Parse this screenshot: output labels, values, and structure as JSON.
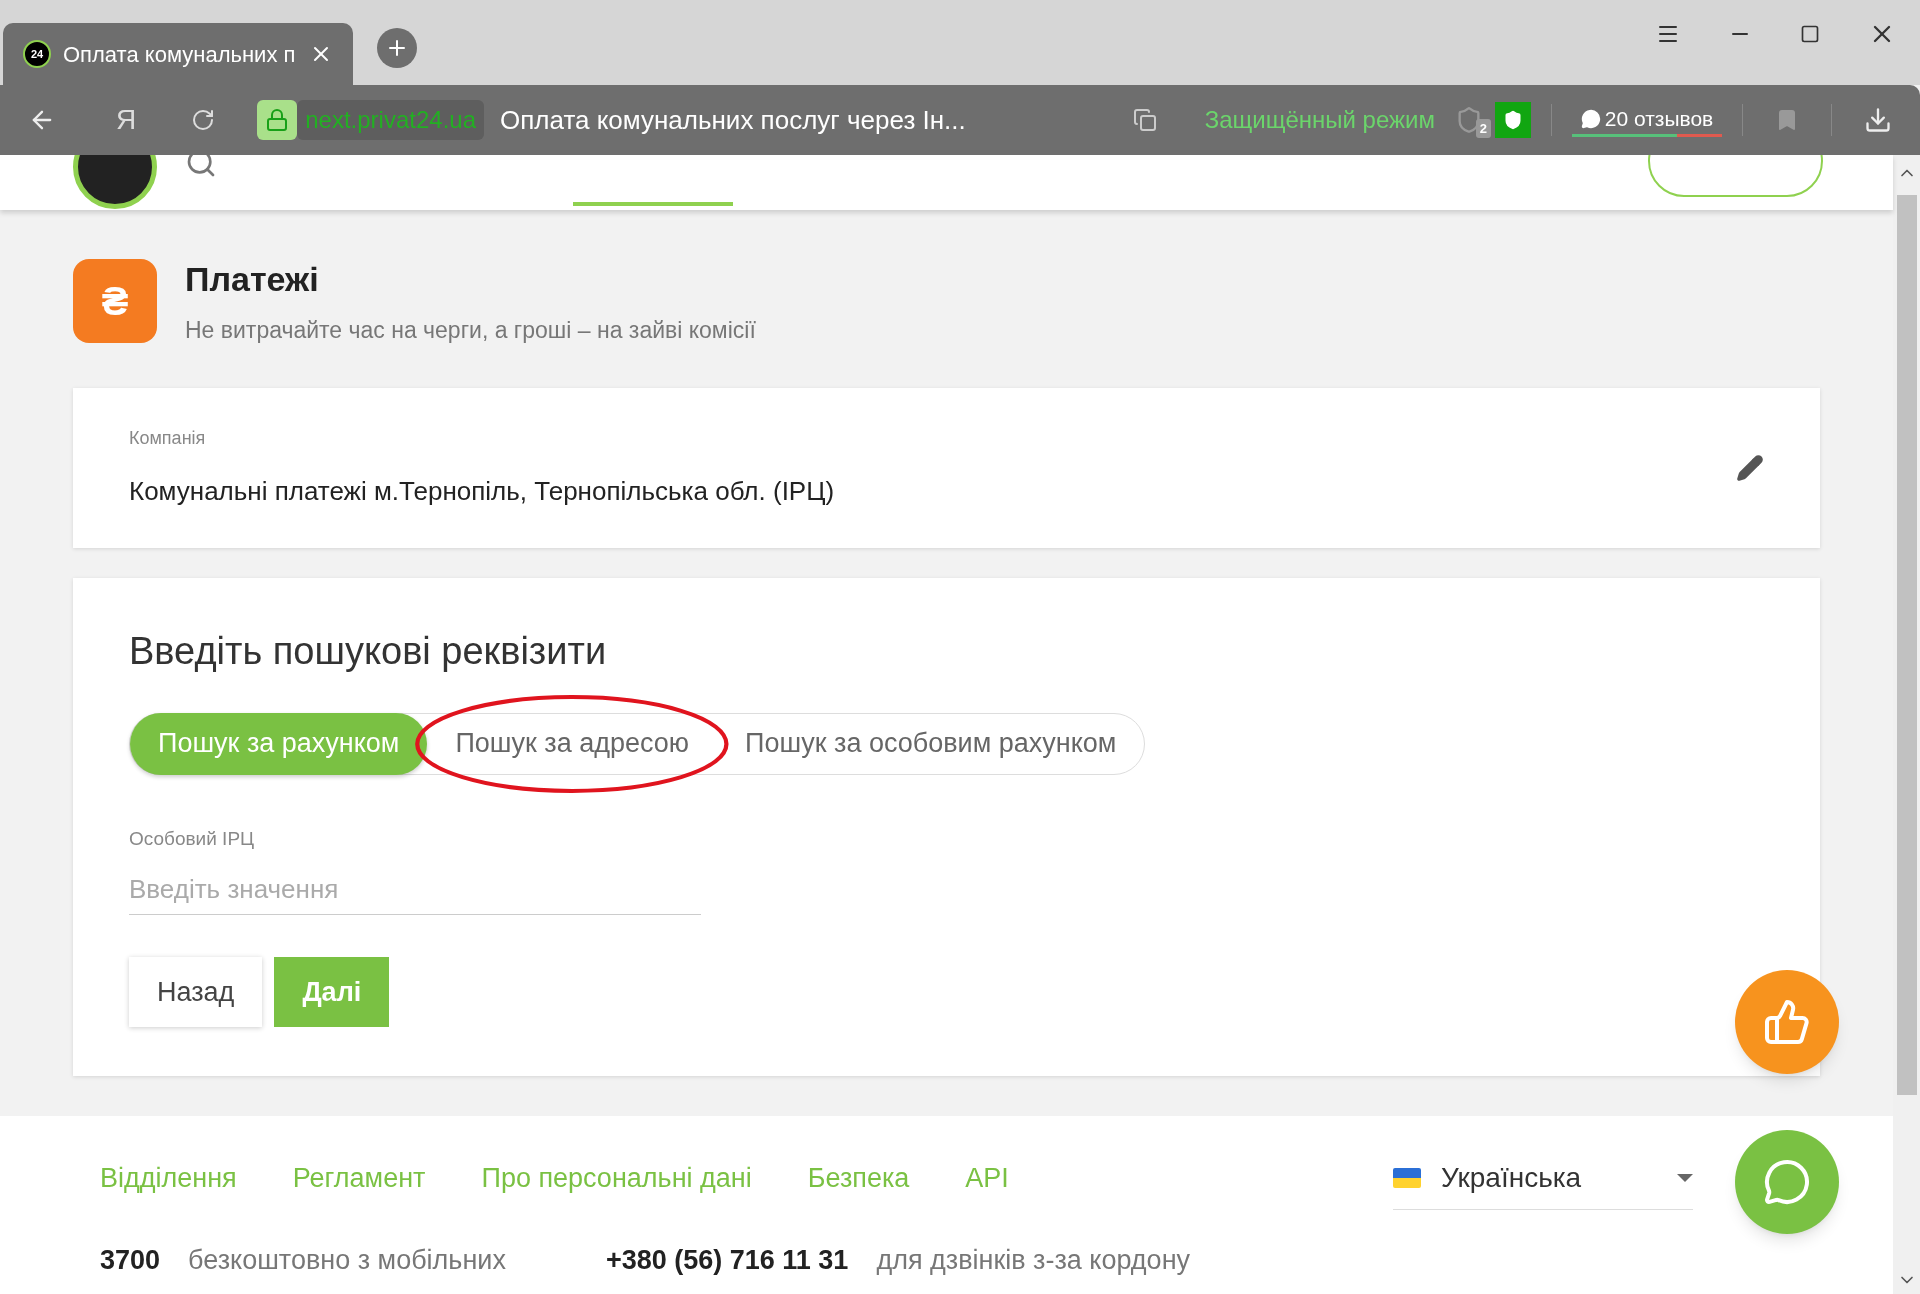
{
  "browser": {
    "favicon": "24",
    "home_button": "Я",
    "tab_title": "Оплата комунальних п",
    "url": "next.privat24.ua",
    "page_title": "Оплата комунальних послуг через Ін...",
    "protected_mode": "Защищённый режим",
    "blocked_count": "2",
    "reviews": "20 отзывов"
  },
  "page": {
    "icon": "₴",
    "title": "Платежі",
    "subtitle": "Не витрачайте час на черги, а гроші – на зайві комісії"
  },
  "company": {
    "label": "Компанія",
    "value": "Комунальні платежі м.Тернопіль, Тернопільська обл. (ІРЦ)"
  },
  "search": {
    "heading": "Введіть пошукові реквізити",
    "modes": [
      {
        "label": "Пошук за рахунком",
        "selected": true,
        "circled": false
      },
      {
        "label": "Пошук за адресою",
        "selected": false,
        "circled": true
      },
      {
        "label": "Пошук за особовим рахунком",
        "selected": false,
        "circled": false
      }
    ],
    "field": {
      "label": "Особовий ІРЦ",
      "placeholder": "Введіть значення"
    },
    "buttons": [
      {
        "label": "Назад",
        "kind": "secondary"
      },
      {
        "label": "Далі",
        "kind": "primary"
      }
    ]
  },
  "footer": {
    "links": [
      "Відділення",
      "Регламент",
      "Про персональні дані",
      "Безпека",
      "API"
    ],
    "language": "Українська",
    "contacts": [
      {
        "number": "3700",
        "note": "безкоштовно з мобільних"
      },
      {
        "number": "+380 (56) 716 11 31",
        "note": "для дзвінків з-за кордону"
      }
    ]
  }
}
